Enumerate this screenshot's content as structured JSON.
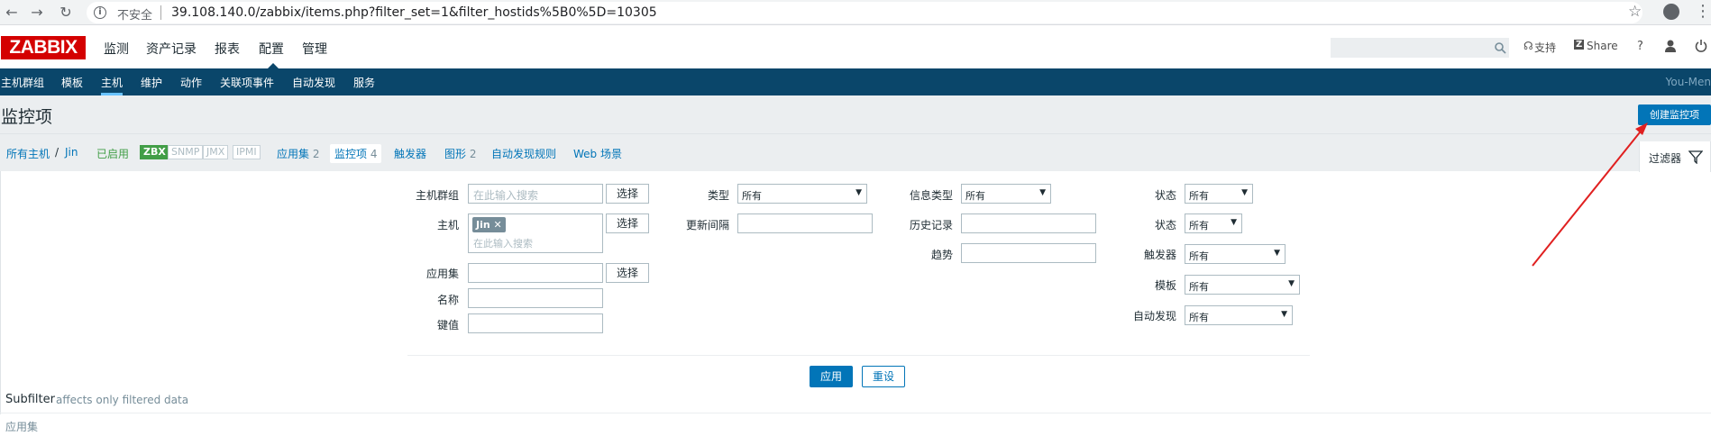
{
  "browser": {
    "insecure_label": "不安全",
    "url": "39.108.140.0/zabbix/items.php?filter_set=1&filter_hostids%5B0%5D=10305"
  },
  "topmenu": {
    "logo": "ZABBIX",
    "items": [
      "监测",
      "资产记录",
      "报表",
      "配置",
      "管理"
    ],
    "support": "支持",
    "share": "Share",
    "help": "?"
  },
  "submenu": {
    "items": [
      "主机群组",
      "模板",
      "主机",
      "维护",
      "动作",
      "关联项事件",
      "自动发现",
      "服务"
    ],
    "selected": "主机",
    "user": "You-Men"
  },
  "header": {
    "title": "监控项",
    "create_button": "创建监控项"
  },
  "breadcrumb": {
    "all_hosts": "所有主机",
    "separator": "/",
    "host": "Jin",
    "enabled": "已启用",
    "tags": [
      "ZBX",
      "SNMP",
      "JMX",
      "IPMI"
    ],
    "tabs": [
      {
        "label": "应用集",
        "count": "2"
      },
      {
        "label": "监控项",
        "count": "4"
      },
      {
        "label": "触发器",
        "count": ""
      },
      {
        "label": "图形",
        "count": "2"
      },
      {
        "label": "自动发现规则",
        "count": ""
      },
      {
        "label": "Web 场景",
        "count": ""
      }
    ],
    "filter_tab": "过滤器"
  },
  "filter": {
    "host_group_label": "主机群组",
    "host_group_placeholder": "在此输入搜索",
    "select_button": "选择",
    "host_label": "主机",
    "host_chip": "Jin",
    "host_placeholder": "在此输入搜索",
    "app_label": "应用集",
    "name_label": "名称",
    "key_label": "键值",
    "type_label": "类型",
    "type_value": "所有",
    "interval_label": "更新间隔",
    "info_type_label": "信息类型",
    "info_type_value": "所有",
    "history_label": "历史记录",
    "trends_label": "趋势",
    "state_label": "状态",
    "state_value": "所有",
    "status_label": "状态",
    "status_value": "所有",
    "triggers_label": "触发器",
    "triggers_value": "所有",
    "template_label": "模板",
    "template_value": "所有",
    "discovery_label": "自动发现",
    "discovery_value": "所有",
    "apply_button": "应用",
    "reset_button": "重设"
  },
  "subfilter": {
    "title": "Subfilter",
    "note": "affects only filtered data",
    "app_sets": "应用集"
  }
}
